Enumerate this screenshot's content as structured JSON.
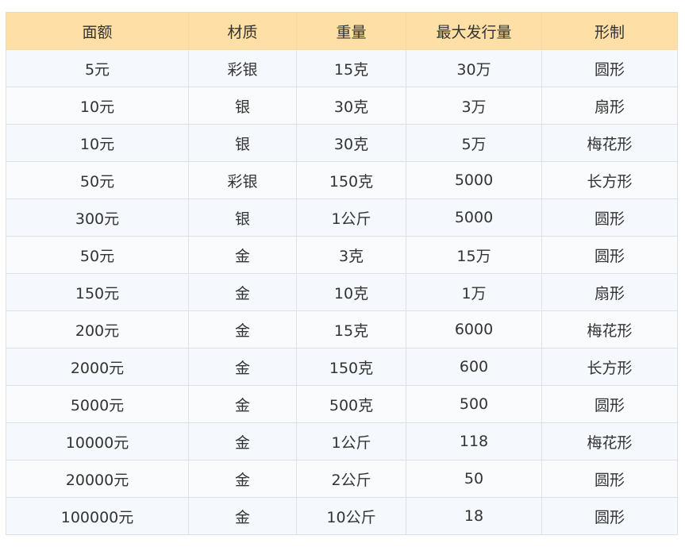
{
  "table": {
    "headers": [
      "面额",
      "材质",
      "重量",
      "最大发行量",
      "形制"
    ],
    "rows": [
      [
        "5元",
        "彩银",
        "15克",
        "30万",
        "圆形"
      ],
      [
        "10元",
        "银",
        "30克",
        "3万",
        "扇形"
      ],
      [
        "10元",
        "银",
        "30克",
        "5万",
        "梅花形"
      ],
      [
        "50元",
        "彩银",
        "150克",
        "5000",
        "长方形"
      ],
      [
        "300元",
        "银",
        "1公斤",
        "5000",
        "圆形"
      ],
      [
        "50元",
        "金",
        "3克",
        "15万",
        "圆形"
      ],
      [
        "150元",
        "金",
        "10克",
        "1万",
        "扇形"
      ],
      [
        "200元",
        "金",
        "15克",
        "6000",
        "梅花形"
      ],
      [
        "2000元",
        "金",
        "150克",
        "600",
        "长方形"
      ],
      [
        "5000元",
        "金",
        "500克",
        "500",
        "圆形"
      ],
      [
        "10000元",
        "金",
        "1公斤",
        "118",
        "梅花形"
      ],
      [
        "20000元",
        "金",
        "2公斤",
        "50",
        "圆形"
      ],
      [
        "100000元",
        "金",
        "10公斤",
        "18",
        "圆形"
      ]
    ]
  },
  "colors": {
    "header_bg": "#fedfa6",
    "row_odd_bg": "#f5f9fd",
    "row_even_bg": "#fafbfc",
    "border": "#dde1e6",
    "text": "#333333"
  }
}
